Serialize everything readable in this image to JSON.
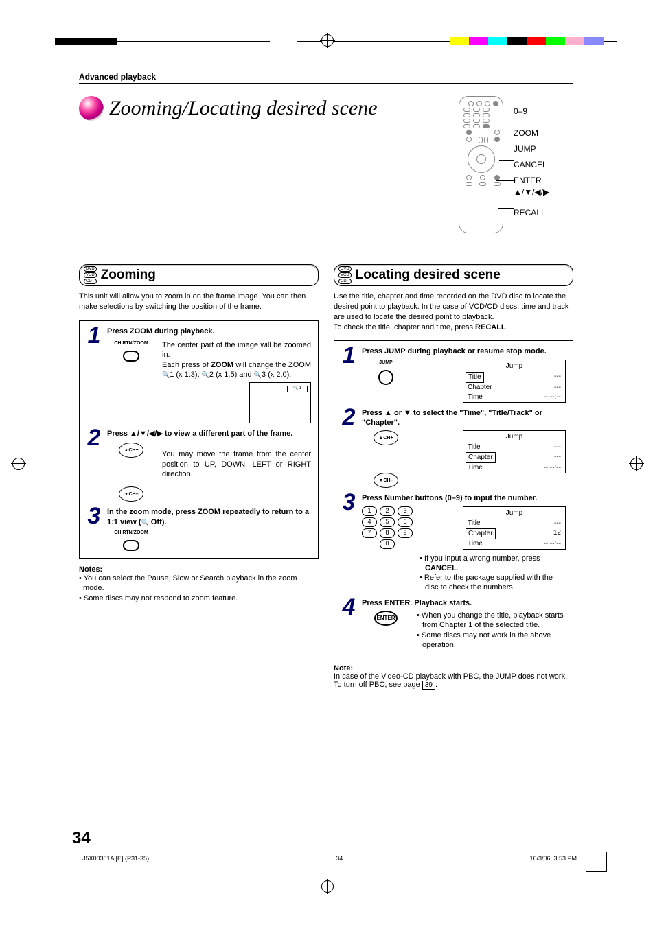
{
  "header": "Advanced playback",
  "title": "Zooming/Locating desired scene",
  "remote_labels": [
    "0–9",
    "ZOOM",
    "JUMP",
    "CANCEL",
    "ENTER",
    "▲/▼/◀/▶",
    "RECALL"
  ],
  "zooming": {
    "disc_types": [
      "DVD",
      "VCD",
      "CD"
    ],
    "heading": "Zooming",
    "intro": "This unit will allow you to zoom in on the frame image. You can then make selections by switching the position of the frame.",
    "steps": [
      {
        "num": "1",
        "title": "Press ZOOM during playback.",
        "icon_label": "CH RTN/ZOOM",
        "text_parts": {
          "a": "The center part of the image will be zoomed in.",
          "b_pre": "Each press of ",
          "b_bold": "ZOOM",
          "b_post": " will change the ZOOM ",
          "c": "1 (x 1.3), ",
          "d": "2 (x 1.5) and ",
          "e": "3 (x 2.0)."
        },
        "screen_indicator": "🔍 1"
      },
      {
        "num": "2",
        "title": "Press ▲/▼/◀/▶ to view a different part of the frame.",
        "icons": [
          "▲CH+",
          "▼CH–"
        ],
        "text": "You may move the frame from the center position to UP, DOWN, LEFT or RIGHT direction."
      },
      {
        "num": "3",
        "title_pre": "In the zoom mode, press ZOOM repeatedly to return to a 1:1 view (",
        "title_post": " Off).",
        "icon_label": "CH RTN/ZOOM"
      }
    ],
    "notes_title": "Notes:",
    "notes": [
      "You can select the Pause, Slow or Search playback in the zoom mode.",
      "Some discs may not respond to zoom feature."
    ]
  },
  "locating": {
    "disc_types": [
      "DVD",
      "VCD",
      "CD"
    ],
    "heading": "Locating desired scene",
    "intro_main": "Use the title, chapter and time recorded on the DVD disc to locate the desired point to playback. In the case of VCD/CD discs, time and track are used to locate the desired point to playback.",
    "intro_check_pre": "To check the title, chapter and time, press ",
    "intro_check_bold": "RECALL",
    "intro_check_post": ".",
    "steps": [
      {
        "num": "1",
        "title": "Press JUMP during playback or resume stop mode.",
        "icon_label": "JUMP",
        "osd": {
          "title": "Jump",
          "rows": [
            {
              "label": "Title",
              "value": "---",
              "boxed": true
            },
            {
              "label": "Chapter",
              "value": "---"
            },
            {
              "label": "Time",
              "value": "--:--:--"
            }
          ]
        }
      },
      {
        "num": "2",
        "title": "Press ▲ or ▼ to select the \"Time\", \"Title/Track\" or \"Chapter\".",
        "icons": [
          "▲CH+",
          "▼CH–"
        ],
        "osd": {
          "title": "Jump",
          "rows": [
            {
              "label": "Title",
              "value": "---"
            },
            {
              "label": "Chapter",
              "value": "---",
              "boxed": true
            },
            {
              "label": "Time",
              "value": "--:--:--"
            }
          ]
        }
      },
      {
        "num": "3",
        "title": "Press Number buttons (0–9) to input the number.",
        "numpad": [
          [
            "1",
            "2",
            "3"
          ],
          [
            "4",
            "5",
            "6"
          ],
          [
            "7",
            "8",
            "9"
          ],
          [
            "0"
          ]
        ],
        "osd": {
          "title": "Jump",
          "rows": [
            {
              "label": "Title",
              "value": "---"
            },
            {
              "label": "Chapter",
              "value": "12",
              "boxed": true
            },
            {
              "label": "Time",
              "value": "--:--:--"
            }
          ]
        },
        "bullets_parts": [
          {
            "pre": "If you input a wrong number, press ",
            "bold": "CANCEL",
            "post": "."
          },
          {
            "text": "Refer to the package supplied with the disc to check the numbers."
          }
        ]
      },
      {
        "num": "4",
        "title": "Press ENTER. Playback starts.",
        "icon_label": "ENTER",
        "bullets": [
          "When you change the title, playback starts from Chapter 1 of the selected title.",
          "Some discs may not work in the above operation."
        ]
      }
    ],
    "note_title": "Note:",
    "note_pre": "In case of the Video-CD playback with PBC, the JUMP does not work. To turn off PBC, see page ",
    "note_page": "39",
    "note_post": "."
  },
  "page_number": "34",
  "footer": {
    "left": "J5X00301A [E] (P31-35)",
    "center": "34",
    "right": "16/3/06, 3:53 PM"
  },
  "color_squares": [
    "#ffff00",
    "#ff00ff",
    "#00ffff",
    "#000000",
    "#ff0000",
    "#00ff00",
    "#ffb0cc",
    "#8888ff"
  ]
}
